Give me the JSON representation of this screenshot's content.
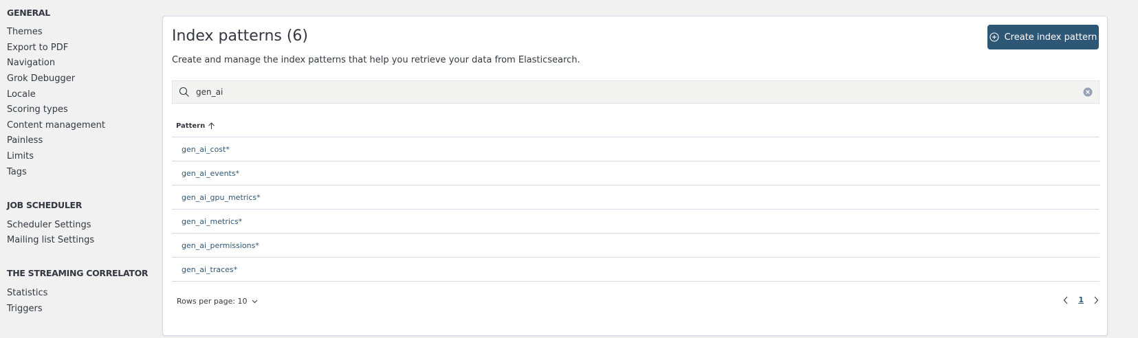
{
  "sidebar": {
    "general_title": "GENERAL",
    "general_items": [
      "Themes",
      "Export to PDF",
      "Navigation",
      "Grok Debugger",
      "Locale",
      "Scoring types",
      "Content management",
      "Painless",
      "Limits",
      "Tags"
    ],
    "job_title": "JOB SCHEDULER",
    "job_items": [
      "Scheduler Settings",
      "Mailing list Settings"
    ],
    "streaming_title": "THE STREAMING CORRELATOR",
    "streaming_items": [
      "Statistics",
      "Triggers"
    ]
  },
  "main": {
    "title": "Index patterns (6)",
    "description": "Create and manage the index patterns that help you retrieve your data from Elasticsearch.",
    "create_button_label": "Create index pattern",
    "search": {
      "value": "gen_ai",
      "icon": "search-icon",
      "clear_icon": "clear-icon"
    },
    "table": {
      "column_header": "Pattern",
      "sort_icon": "arrow-up-icon",
      "rows": [
        "gen_ai_cost*",
        "gen_ai_events*",
        "gen_ai_gpu_metrics*",
        "gen_ai_metrics*",
        "gen_ai_permissions*",
        "gen_ai_traces*"
      ]
    },
    "footer": {
      "rows_per_page": "Rows per page: 10",
      "current_page": "1"
    }
  },
  "colors": {
    "accent": "#2e5675",
    "background": "#f1f1f1",
    "panel": "#ffffff",
    "border": "#d3dae6",
    "text": "#343741"
  }
}
